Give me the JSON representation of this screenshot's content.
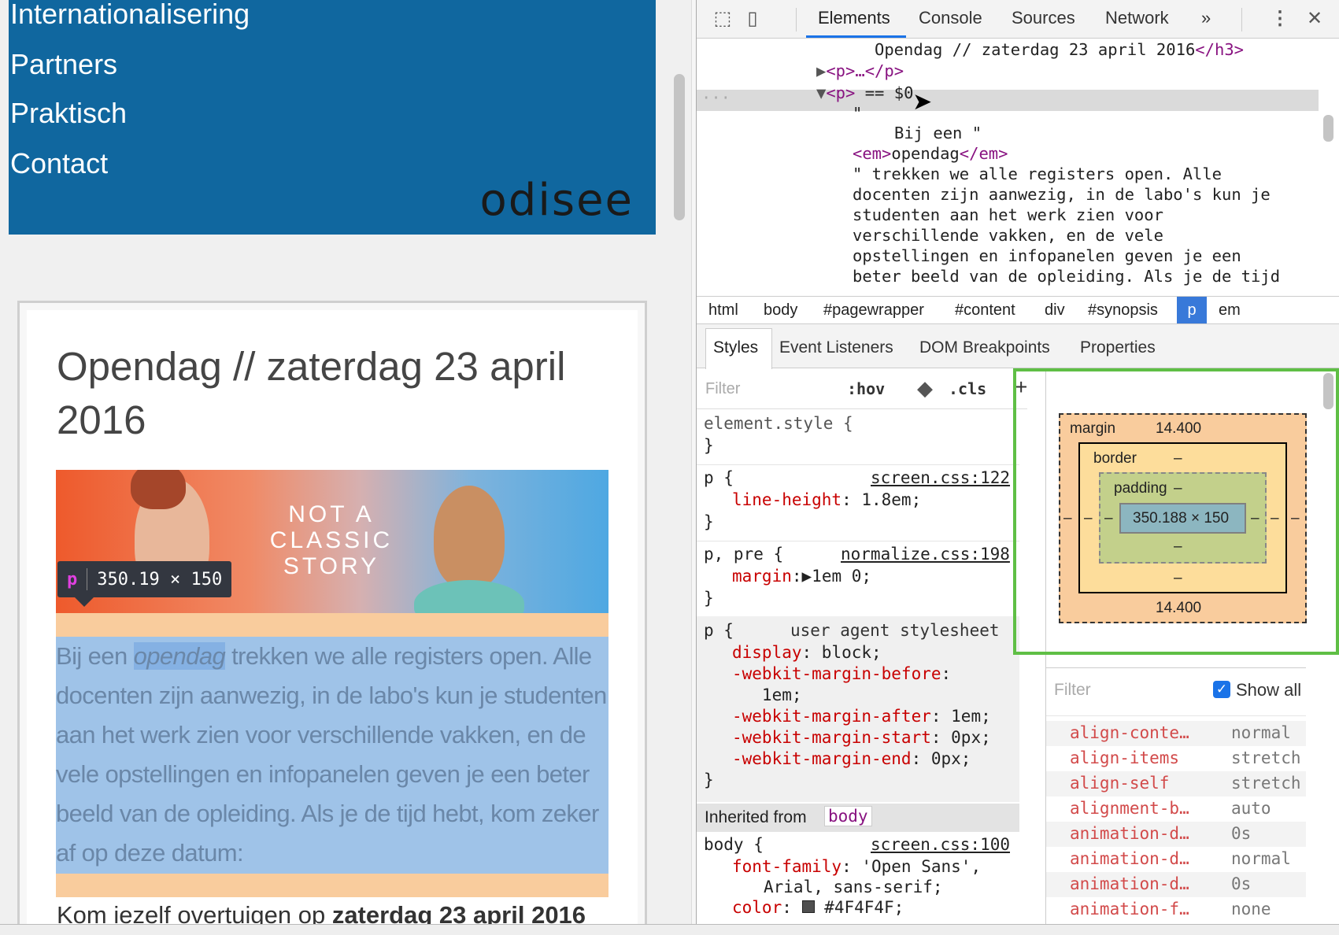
{
  "page": {
    "nav": [
      "Internationalisering",
      "Partners",
      "Praktisch",
      "Contact"
    ],
    "logo": "odisee",
    "title": "Opendag // zaterdag 23 april 2016",
    "banner_text": [
      "NOT A",
      "CLASSIC",
      "STORY"
    ],
    "tooltip": {
      "tag": "p",
      "size": "350.19 × 150"
    },
    "para": {
      "before": "Bij een ",
      "em": "opendag",
      "after": " trekken we alle registers open. Alle docenten zijn aanwezig, in de labo's kun je studenten aan het werk zien voor verschillende vakken, en de vele opstellingen en infopanelen geven je een beter beeld van de opleiding. Als je de tijd hebt, kom zeker af op deze datum:"
    },
    "next": {
      "text": "Kom iezelf overtuigen op ",
      "bold": "zaterdag 23 april 2016"
    }
  },
  "devtools": {
    "tabs": [
      "Elements",
      "Console",
      "Sources",
      "Network",
      "»"
    ],
    "active_tab": "Elements",
    "tree": {
      "h3_text": "Opendag // zaterdag 23 april 2016",
      "h3_close": "</h3>",
      "p_collapsed": "<p>…</p>",
      "p_open": "<p>",
      "selected_marker": "== $0",
      "quote": "\"",
      "bij_een": "Bij een \"",
      "em_open": "<em>",
      "em_text": "opendag",
      "em_close": "</em>",
      "lines": [
        "\" trekken we alle registers open. Alle",
        "docenten zijn aanwezig, in de labo's kun je",
        "studenten aan het werk zien voor",
        "verschillende vakken, en de vele",
        "opstellingen en infopanelen geven je een",
        "beter beeld van de opleiding. Als je de tijd"
      ]
    },
    "breadcrumbs": [
      "html",
      "body",
      "#pagewrapper",
      "#content",
      "div",
      "#synopsis",
      "p",
      "em"
    ],
    "active_crumb": "p",
    "panel_tabs": [
      "Styles",
      "Event Listeners",
      "DOM Breakpoints",
      "Properties"
    ],
    "styles": {
      "filter_placeholder": "Filter",
      "hov": ":hov",
      "cls": ".cls",
      "add": "+",
      "element_style": "element.style {",
      "close": "}",
      "rule1": {
        "sel": "p {",
        "src": "screen.css:122",
        "prop": "line-height",
        "val": ": 1.8em;"
      },
      "rule2": {
        "sel": "p, pre {",
        "src": "normalize.css:198",
        "prop": "margin",
        "val": "1em 0;"
      },
      "rule3": {
        "sel": "p {",
        "src": "user agent stylesheet",
        "props": [
          [
            "display",
            ": block;"
          ],
          [
            "-webkit-margin-before",
            ":"
          ],
          [
            "",
            "   1em;"
          ],
          [
            "-webkit-margin-after",
            ": 1em;"
          ],
          [
            "-webkit-margin-start",
            ": 0px;"
          ],
          [
            "-webkit-margin-end",
            ": 0px;"
          ]
        ]
      },
      "inherited_label": "Inherited from",
      "inherited_from": "body",
      "rule4": {
        "sel": "body {",
        "src": "screen.css:100",
        "prop1": "font-family",
        "val1": ": 'Open Sans',",
        "val1b": "Arial, sans-serif;",
        "prop2": "color",
        "val2": "#4F4F4F;",
        "swatch": "#4F4F4F"
      }
    },
    "boxmodel": {
      "margin_label": "margin",
      "margin_top": "14.400",
      "margin_bottom": "14.400",
      "border_label": "border",
      "padding_label": "padding",
      "dash": "–",
      "content": "350.188 × 150"
    },
    "computed": {
      "filter_placeholder": "Filter",
      "show_all": "Show all",
      "show_all_checked": true,
      "rows": [
        [
          "align-conte…",
          "normal"
        ],
        [
          "align-items",
          "stretch"
        ],
        [
          "align-self",
          "stretch"
        ],
        [
          "alignment-b…",
          "auto"
        ],
        [
          "animation-d…",
          "0s"
        ],
        [
          "animation-d…",
          "normal"
        ],
        [
          "animation-d…",
          "0s"
        ],
        [
          "animation-f…",
          "none"
        ]
      ]
    }
  },
  "colors": {
    "header": "#10679f",
    "margin": "#f9cc9d",
    "content_hl": "#9fc3e8",
    "active_tab": "#1a73e8",
    "green_highlight": "#5fbf45"
  }
}
